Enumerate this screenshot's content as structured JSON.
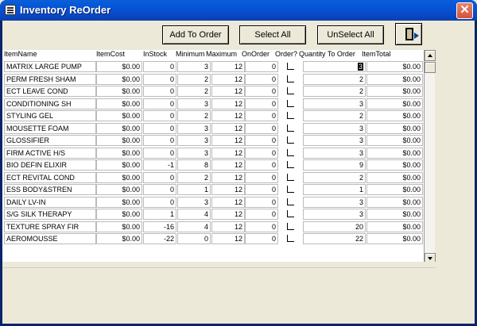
{
  "window": {
    "title": "Inventory ReOrder"
  },
  "toolbar": {
    "add_label": "Add To Order",
    "select_all_label": "Select All",
    "unselect_all_label": "UnSelect All"
  },
  "columns": [
    "ItemName",
    "ItemCost",
    "InStock",
    "Minimum",
    "Maximum",
    "OnOrder",
    "Order?",
    "Quantity To Order",
    "ItemTotal"
  ],
  "rows": [
    {
      "name": "MATRIX LARGE PUMP",
      "cost": "$0.00",
      "instock": "0",
      "min": "3",
      "max": "12",
      "onorder": "0",
      "qty": "3",
      "total": "$0.00"
    },
    {
      "name": "PERM FRESH SHAM",
      "cost": "$0.00",
      "instock": "0",
      "min": "2",
      "max": "12",
      "onorder": "0",
      "qty": "2",
      "total": "$0.00"
    },
    {
      "name": "ECT LEAVE COND",
      "cost": "$0.00",
      "instock": "0",
      "min": "2",
      "max": "12",
      "onorder": "0",
      "qty": "2",
      "total": "$0.00"
    },
    {
      "name": "CONDITIONING SH",
      "cost": "$0.00",
      "instock": "0",
      "min": "3",
      "max": "12",
      "onorder": "0",
      "qty": "3",
      "total": "$0.00"
    },
    {
      "name": "STYLING GEL",
      "cost": "$0.00",
      "instock": "0",
      "min": "2",
      "max": "12",
      "onorder": "0",
      "qty": "2",
      "total": "$0.00"
    },
    {
      "name": "MOUSETTE FOAM",
      "cost": "$0.00",
      "instock": "0",
      "min": "3",
      "max": "12",
      "onorder": "0",
      "qty": "3",
      "total": "$0.00"
    },
    {
      "name": "GLOSSIFIER",
      "cost": "$0.00",
      "instock": "0",
      "min": "3",
      "max": "12",
      "onorder": "0",
      "qty": "3",
      "total": "$0.00"
    },
    {
      "name": "FIRM ACTIVE H/S",
      "cost": "$0.00",
      "instock": "0",
      "min": "3",
      "max": "12",
      "onorder": "0",
      "qty": "3",
      "total": "$0.00"
    },
    {
      "name": "BIO DEFIN ELIXIR",
      "cost": "$0.00",
      "instock": "-1",
      "min": "8",
      "max": "12",
      "onorder": "0",
      "qty": "9",
      "total": "$0.00"
    },
    {
      "name": "ECT REVITAL COND",
      "cost": "$0.00",
      "instock": "0",
      "min": "2",
      "max": "12",
      "onorder": "0",
      "qty": "2",
      "total": "$0.00"
    },
    {
      "name": "ESS BODY&STREN",
      "cost": "$0.00",
      "instock": "0",
      "min": "1",
      "max": "12",
      "onorder": "0",
      "qty": "1",
      "total": "$0.00"
    },
    {
      "name": "DAILY LV-IN",
      "cost": "$0.00",
      "instock": "0",
      "min": "3",
      "max": "12",
      "onorder": "0",
      "qty": "3",
      "total": "$0.00"
    },
    {
      "name": "S/G SILK THERAPY",
      "cost": "$0.00",
      "instock": "1",
      "min": "4",
      "max": "12",
      "onorder": "0",
      "qty": "3",
      "total": "$0.00"
    },
    {
      "name": "TEXTURE SPRAY FIR",
      "cost": "$0.00",
      "instock": "-16",
      "min": "4",
      "max": "12",
      "onorder": "0",
      "qty": "20",
      "total": "$0.00"
    },
    {
      "name": "AEROMOUSSE",
      "cost": "$0.00",
      "instock": "-22",
      "min": "0",
      "max": "12",
      "onorder": "0",
      "qty": "22",
      "total": "$0.00"
    }
  ]
}
